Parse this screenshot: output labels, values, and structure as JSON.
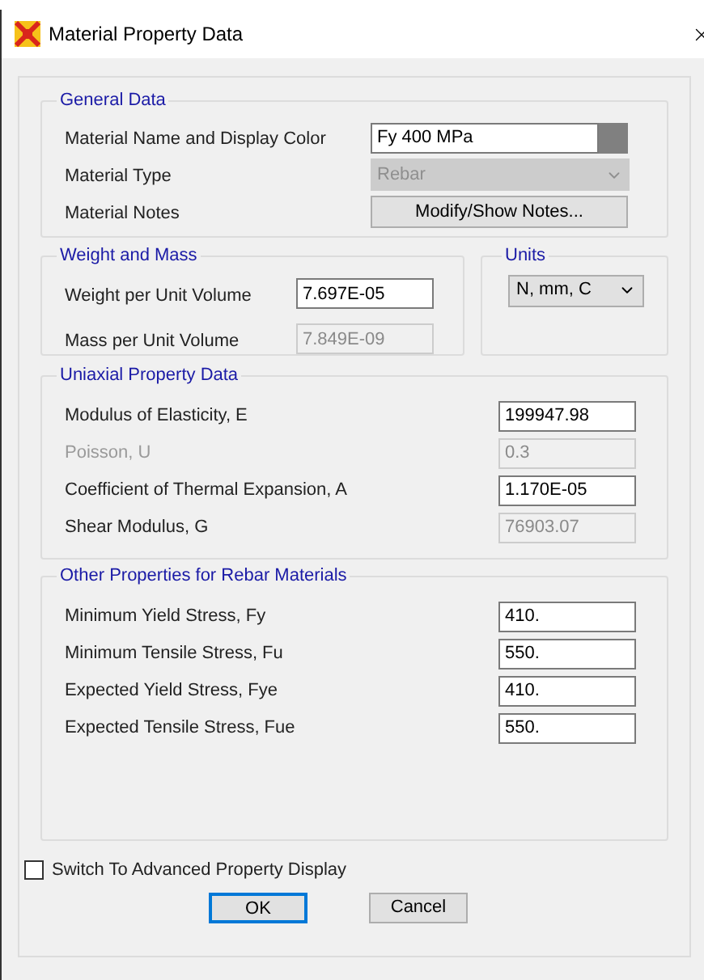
{
  "window": {
    "title": "Material Property Data"
  },
  "general": {
    "title": "General Data",
    "rows": [
      {
        "label": "Material Name and Display Color",
        "kind": "name",
        "value": "Fy 400 MPa",
        "color": "#808080",
        "disabled": false
      },
      {
        "label": "Material Type",
        "kind": "dropdown",
        "value": "Rebar",
        "disabled": true
      },
      {
        "label": "Material Notes",
        "kind": "button",
        "value": "Modify/Show Notes...",
        "disabled": false
      }
    ]
  },
  "weight": {
    "title": "Weight and Mass",
    "rows": [
      {
        "label": "Weight per Unit Volume",
        "value": "7.697E-05",
        "disabled": false
      },
      {
        "label": "Mass per Unit Volume",
        "value": "7.849E-09",
        "disabled": true
      }
    ]
  },
  "units": {
    "title": "Units",
    "value": "N, mm, C"
  },
  "uniaxial": {
    "title": "Uniaxial Property Data",
    "rows": [
      {
        "label": "Modulus of Elasticity,  E",
        "value": "199947.98",
        "disabled": false
      },
      {
        "label": "Poisson,  U",
        "value": "0.3",
        "disabled": true
      },
      {
        "label": "Coefficient of Thermal Expansion,  A",
        "value": "1.170E-05",
        "disabled": false
      },
      {
        "label": "Shear Modulus,  G",
        "value": "76903.07",
        "disabled": true
      }
    ]
  },
  "rebar": {
    "title": "Other Properties for Rebar Materials",
    "rows": [
      {
        "label": "Minimum Yield Stress, Fy",
        "value": "410.",
        "disabled": false
      },
      {
        "label": "Minimum Tensile Stress, Fu",
        "value": "550.",
        "disabled": false
      },
      {
        "label": "Expected Yield Stress, Fye",
        "value": "410.",
        "disabled": false
      },
      {
        "label": "Expected Tensile Stress, Fue",
        "value": "550.",
        "disabled": false
      }
    ]
  },
  "advanced": {
    "label": "Switch To Advanced Property Display",
    "checked": false
  },
  "buttons": [
    {
      "label": "OK",
      "default": true
    },
    {
      "label": "Cancel",
      "default": false
    }
  ]
}
